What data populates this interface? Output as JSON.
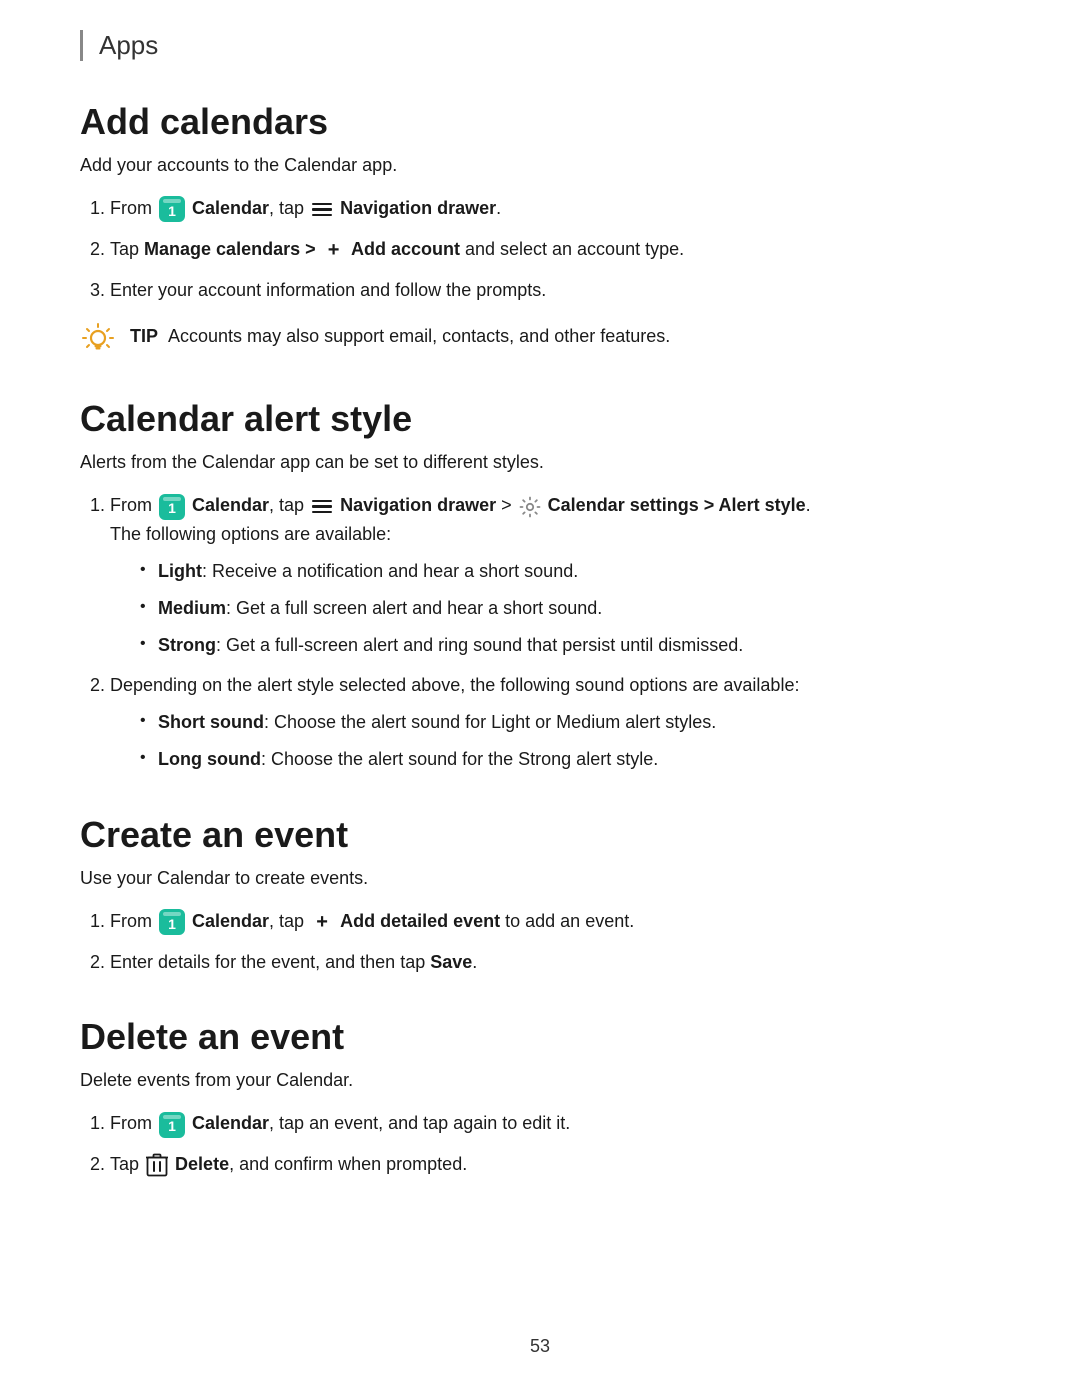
{
  "header": {
    "title": "Apps"
  },
  "sections": [
    {
      "id": "add-calendars",
      "heading": "Add calendars",
      "intro": "Add your accounts to the Calendar app.",
      "steps": [
        {
          "html_id": "add-step-1",
          "text": "From {calendar} Calendar, tap {nav} Navigation drawer."
        },
        {
          "html_id": "add-step-2",
          "text": "Tap Manage calendars > {plus} Add account and select an account type."
        },
        {
          "html_id": "add-step-3",
          "text": "Enter your account information and follow the prompts."
        }
      ],
      "tip": "Accounts may also support email, contacts, and other features."
    },
    {
      "id": "calendar-alert-style",
      "heading": "Calendar alert style",
      "intro": "Alerts from the Calendar app can be set to different styles.",
      "steps": [
        {
          "html_id": "alert-step-1",
          "text": "From {calendar} Calendar, tap {nav} Navigation drawer > {gear} Calendar settings > Alert style.",
          "subtext": "The following options are available:",
          "bullets": [
            {
              "label": "Light",
              "text": "Receive a notification and hear a short sound."
            },
            {
              "label": "Medium",
              "text": "Get a full screen alert and hear a short sound."
            },
            {
              "label": "Strong",
              "text": "Get a full-screen alert and ring sound that persist until dismissed."
            }
          ]
        },
        {
          "html_id": "alert-step-2",
          "text": "Depending on the alert style selected above, the following sound options are available:",
          "bullets": [
            {
              "label": "Short sound",
              "text": "Choose the alert sound for Light or Medium alert styles."
            },
            {
              "label": "Long sound",
              "text": "Choose the alert sound for the Strong alert style."
            }
          ]
        }
      ]
    },
    {
      "id": "create-an-event",
      "heading": "Create an event",
      "intro": "Use your Calendar to create events.",
      "steps": [
        {
          "html_id": "create-step-1",
          "text": "From {calendar} Calendar, tap {plus} Add detailed event to add an event."
        },
        {
          "html_id": "create-step-2",
          "text": "Enter details for the event, and then tap Save."
        }
      ]
    },
    {
      "id": "delete-an-event",
      "heading": "Delete an event",
      "intro": "Delete events from your Calendar.",
      "steps": [
        {
          "html_id": "delete-step-1",
          "text": "From {calendar} Calendar, tap an event, and tap again to edit it."
        },
        {
          "html_id": "delete-step-2",
          "text": "Tap {trash} Delete, and confirm when prompted."
        }
      ]
    }
  ],
  "page_number": "53"
}
